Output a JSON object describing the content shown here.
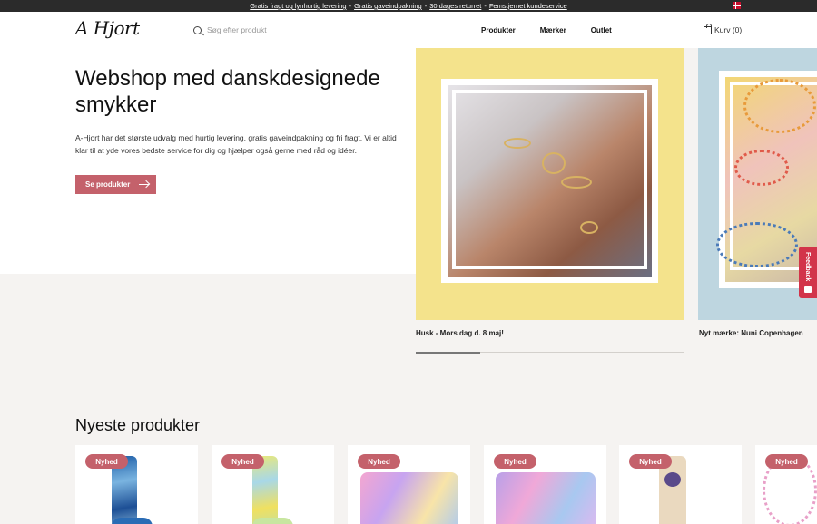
{
  "announcement": {
    "items": [
      "Gratis fragt og lynhurtig levering",
      "Gratis gaveindpakning",
      "30 dages returret",
      "Femstjernet kundeservice"
    ],
    "separator": "-",
    "language_flag": "flag-denmark-icon"
  },
  "header": {
    "logo": "A Hjort",
    "search_placeholder": "Søg efter produkt",
    "nav": [
      "Produkter",
      "Mærker",
      "Outlet"
    ],
    "cart_label": "Kurv (0)"
  },
  "hero": {
    "title": "Webshop med danskdesignede smykker",
    "text": "A-Hjort har det største udvalg med hurtig levering, gratis gaveindpakning og fri fragt. Vi er altid klar til at yde vores bedste service for dig og hjælper også gerne med råd og idéer.",
    "button_label": "Se produkter"
  },
  "slider": {
    "slides": [
      {
        "caption": "Husk - Mors dag d. 8 maj!"
      },
      {
        "caption": "Nyt mærke: Nuni Copenhagen"
      }
    ],
    "progress_fraction": 0.24
  },
  "feedback": {
    "label": "Feedback"
  },
  "newest": {
    "title": "Nyeste produkter",
    "badge": "Nyhed",
    "products": [
      {
        "image": "blue-tie-dye-socks"
      },
      {
        "image": "yellow-tie-dye-socks"
      },
      {
        "image": "pastel-cosmetic-bag"
      },
      {
        "image": "purple-cosmetic-bag"
      },
      {
        "image": "beige-socks"
      },
      {
        "image": "beaded-necklace"
      }
    ]
  },
  "colors": {
    "accent": "#c4616b",
    "topbar": "#2b2b2b",
    "slide1_bg": "#f4e38c",
    "slide2_bg": "#bed6e0",
    "feedback": "#d2344a"
  }
}
